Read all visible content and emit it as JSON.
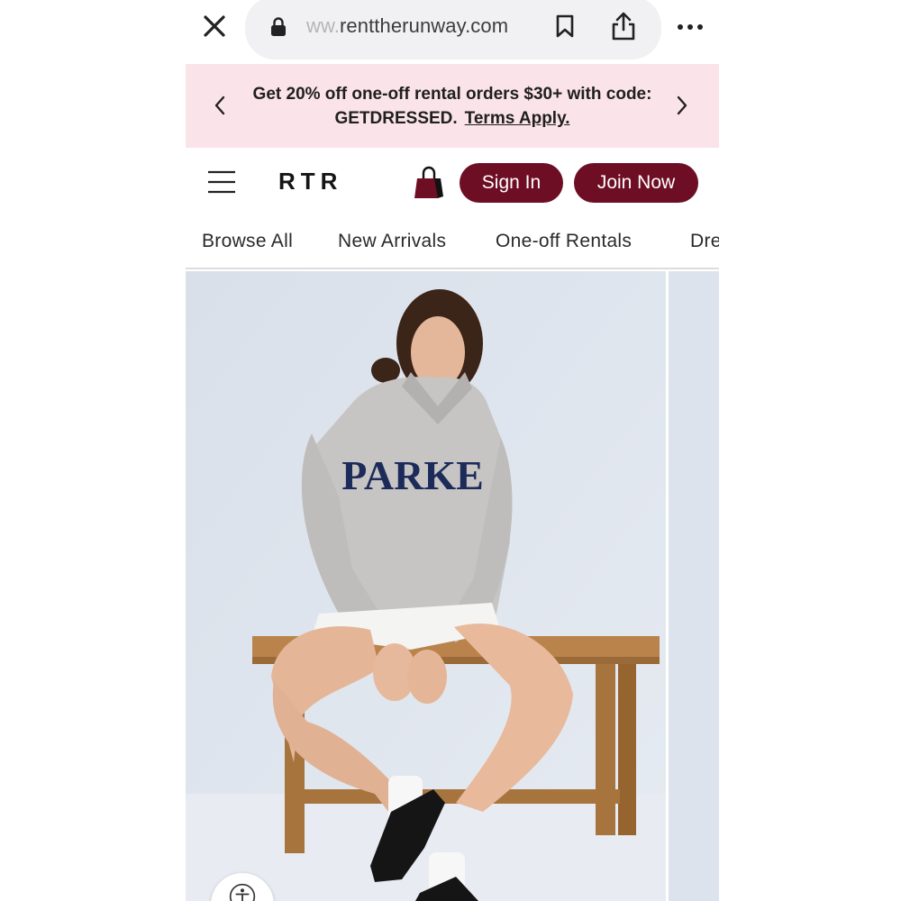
{
  "browser": {
    "url_faded": "ww.",
    "url_main": "renttherunway.com"
  },
  "promo": {
    "text": "Get 20% off one-off rental orders $30+ with code: GETDRESSED.",
    "terms_link": "Terms Apply."
  },
  "header": {
    "logo": "RTR",
    "sign_in_label": "Sign In",
    "join_now_label": "Join Now"
  },
  "nav": {
    "items": [
      {
        "label": "Browse All"
      },
      {
        "label": "New Arrivals"
      },
      {
        "label": "One-off Rentals"
      },
      {
        "label": "Dre"
      }
    ]
  },
  "hero": {
    "sweatshirt_print": "PARKE"
  },
  "colors": {
    "brand": "#6e0e25",
    "promo_bg": "#fbe3ea",
    "sweatshirt_print": "#1c2b5a"
  },
  "icons": [
    "close-icon",
    "lock-icon",
    "bookmark-icon",
    "share-icon",
    "more-icon",
    "chevron-left-icon",
    "chevron-right-icon",
    "hamburger-menu-icon",
    "shopping-bag-icon",
    "accessibility-icon"
  ]
}
